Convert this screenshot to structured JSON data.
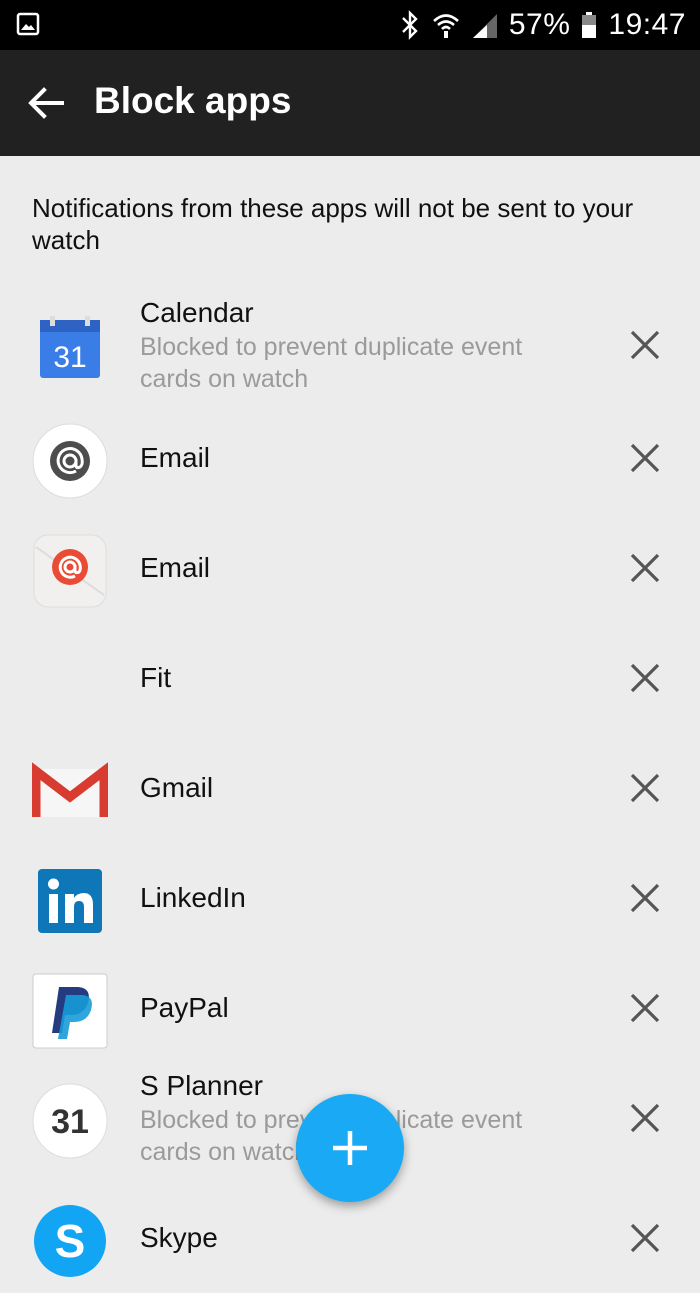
{
  "status_bar": {
    "battery": "57%",
    "time": "19:47"
  },
  "app_bar": {
    "title": "Block apps"
  },
  "description": "Notifications from these apps will not be sent to your watch",
  "apps": [
    {
      "name": "Calendar",
      "subtitle": "Blocked to prevent duplicate event cards on watch",
      "icon": "google-calendar-icon",
      "icon_text": "31"
    },
    {
      "name": "Email",
      "subtitle": "",
      "icon": "email-icon"
    },
    {
      "name": "Email",
      "subtitle": "",
      "icon": "samsung-email-icon"
    },
    {
      "name": "Fit",
      "subtitle": "",
      "icon": ""
    },
    {
      "name": "Gmail",
      "subtitle": "",
      "icon": "gmail-icon"
    },
    {
      "name": "LinkedIn",
      "subtitle": "",
      "icon": "linkedin-icon"
    },
    {
      "name": "PayPal",
      "subtitle": "",
      "icon": "paypal-icon"
    },
    {
      "name": "S Planner",
      "subtitle": "Blocked to prevent duplicate event cards on watch",
      "icon": "s-planner-icon",
      "icon_text": "31"
    },
    {
      "name": "Skype",
      "subtitle": "",
      "icon": "skype-icon"
    }
  ],
  "colors": {
    "accent": "#1aa9f4",
    "app_bar": "#212121",
    "background": "#ececec"
  }
}
